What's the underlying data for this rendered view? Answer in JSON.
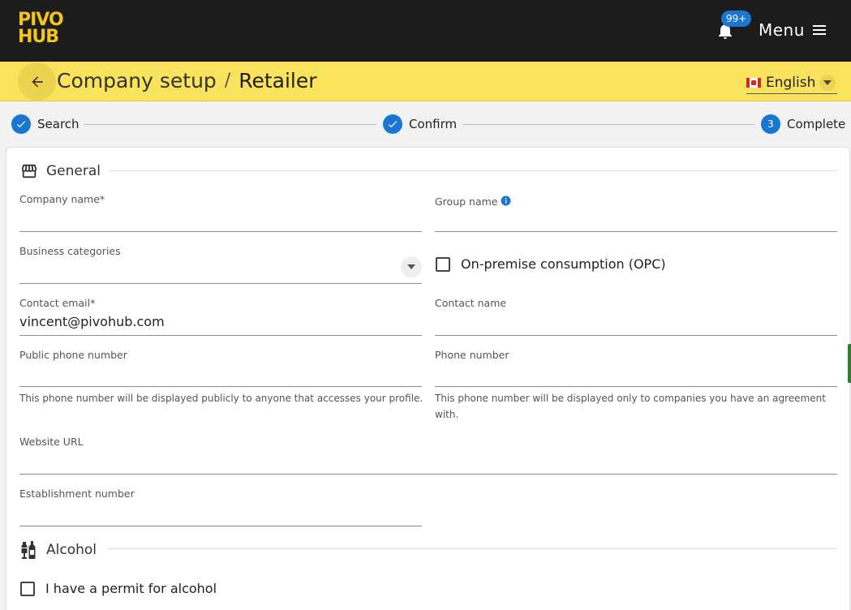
{
  "app": {
    "logo_line1": "PIVO",
    "logo_line2": "HUB",
    "notifications_badge": "99+",
    "menu_label": "Menu"
  },
  "header": {
    "breadcrumb_parent": "Company setup",
    "breadcrumb_separator": "/",
    "breadcrumb_current": "Retailer",
    "language": "English"
  },
  "stepper": {
    "steps": [
      {
        "label": "Search",
        "state": "done"
      },
      {
        "label": "Confirm",
        "state": "done"
      },
      {
        "label": "Complete",
        "state": "active",
        "number": "3"
      }
    ]
  },
  "general": {
    "title": "General",
    "company_name": {
      "label": "Company name",
      "required": "*",
      "value": ""
    },
    "group_name": {
      "label": "Group name",
      "value": ""
    },
    "business_categories": {
      "label": "Business categories",
      "value": ""
    },
    "opc_checkbox": {
      "label": "On-premise consumption (OPC)",
      "checked": false
    },
    "contact_email": {
      "label": "Contact email",
      "required": "*",
      "value": "vincent@pivohub.com"
    },
    "contact_name": {
      "label": "Contact name",
      "value": ""
    },
    "public_phone": {
      "label": "Public phone number",
      "value": "",
      "hint": "This phone number will be displayed publicly to anyone that accesses your profile."
    },
    "phone": {
      "label": "Phone number",
      "value": "",
      "hint": "This phone number will be displayed only to companies you have an agreement with."
    },
    "website": {
      "label": "Website URL",
      "value": ""
    },
    "establishment": {
      "label": "Establishment number",
      "value": ""
    }
  },
  "alcohol": {
    "title": "Alcohol",
    "permit_checkbox": {
      "label": "I have a permit for alcohol",
      "checked": false
    }
  },
  "colors": {
    "topbar": "#1c1c1c",
    "brand_yellow": "#fae35c",
    "accent_blue": "#1976d2"
  }
}
